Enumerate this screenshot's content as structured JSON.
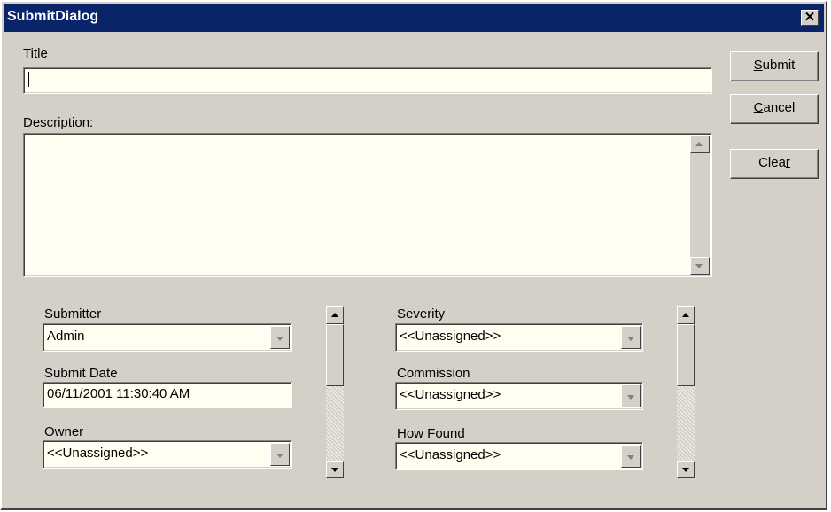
{
  "window": {
    "title": "SubmitDialog",
    "close_glyph": "✕"
  },
  "form": {
    "title_label": "Title",
    "title_value": "",
    "description_label": "Description:",
    "description_value": ""
  },
  "buttons": {
    "submit": "Submit",
    "cancel": "Cancel",
    "clear": "Clear"
  },
  "fields_left": {
    "submitter_label": "Submitter",
    "submitter_value": "Admin",
    "submit_date_label": "Submit Date",
    "submit_date_value": "06/11/2001 11:30:40 AM",
    "owner_label": "Owner",
    "owner_value": "<<Unassigned>>"
  },
  "fields_right": {
    "severity_label": "Severity",
    "severity_value": "<<Unassigned>>",
    "commission_label": "Commission",
    "commission_value": "<<Unassigned>>",
    "how_found_label": "How Found",
    "how_found_value": "<<Unassigned>>"
  },
  "icons": {
    "close": "close-icon",
    "dropdown": "chevron-down-icon",
    "scroll_up": "arrow-up-icon",
    "scroll_down": "arrow-down-icon"
  },
  "colors": {
    "titlebar": "#0a246a",
    "face": "#d4d0c8",
    "field": "#fffef0"
  }
}
